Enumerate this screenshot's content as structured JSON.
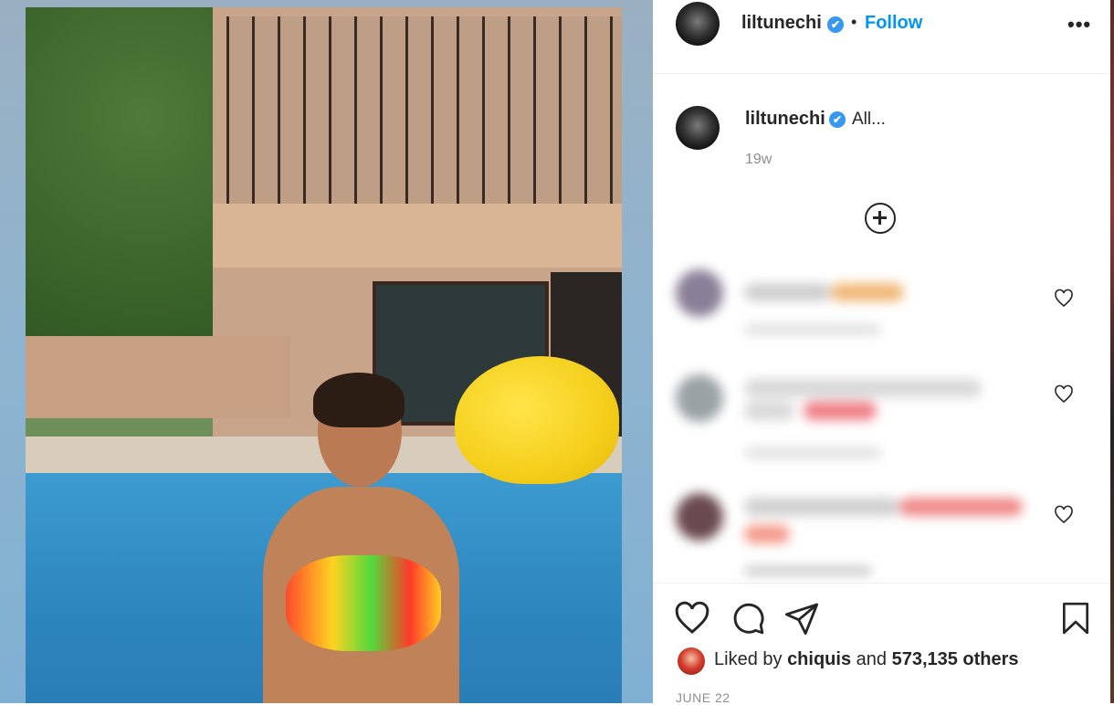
{
  "post": {
    "username": "liltunechi",
    "verified_mark": "✔",
    "separator": "•",
    "follow_label": "Follow",
    "more_label": "•••"
  },
  "caption": {
    "username": "liltunechi",
    "text": "All...",
    "timestamp": "19w"
  },
  "comments": [
    {
      "like_icon": "heart-outline-icon"
    },
    {
      "like_icon": "heart-outline-icon"
    },
    {
      "like_icon": "heart-outline-icon"
    }
  ],
  "actions": {
    "icons": [
      "heart-outline-icon",
      "comment-icon",
      "share-icon",
      "bookmark-icon"
    ]
  },
  "likes": {
    "prefix": "Liked by",
    "user": "chiquis",
    "connector": "and",
    "count": "573,135 others"
  },
  "date": "JUNE 22"
}
